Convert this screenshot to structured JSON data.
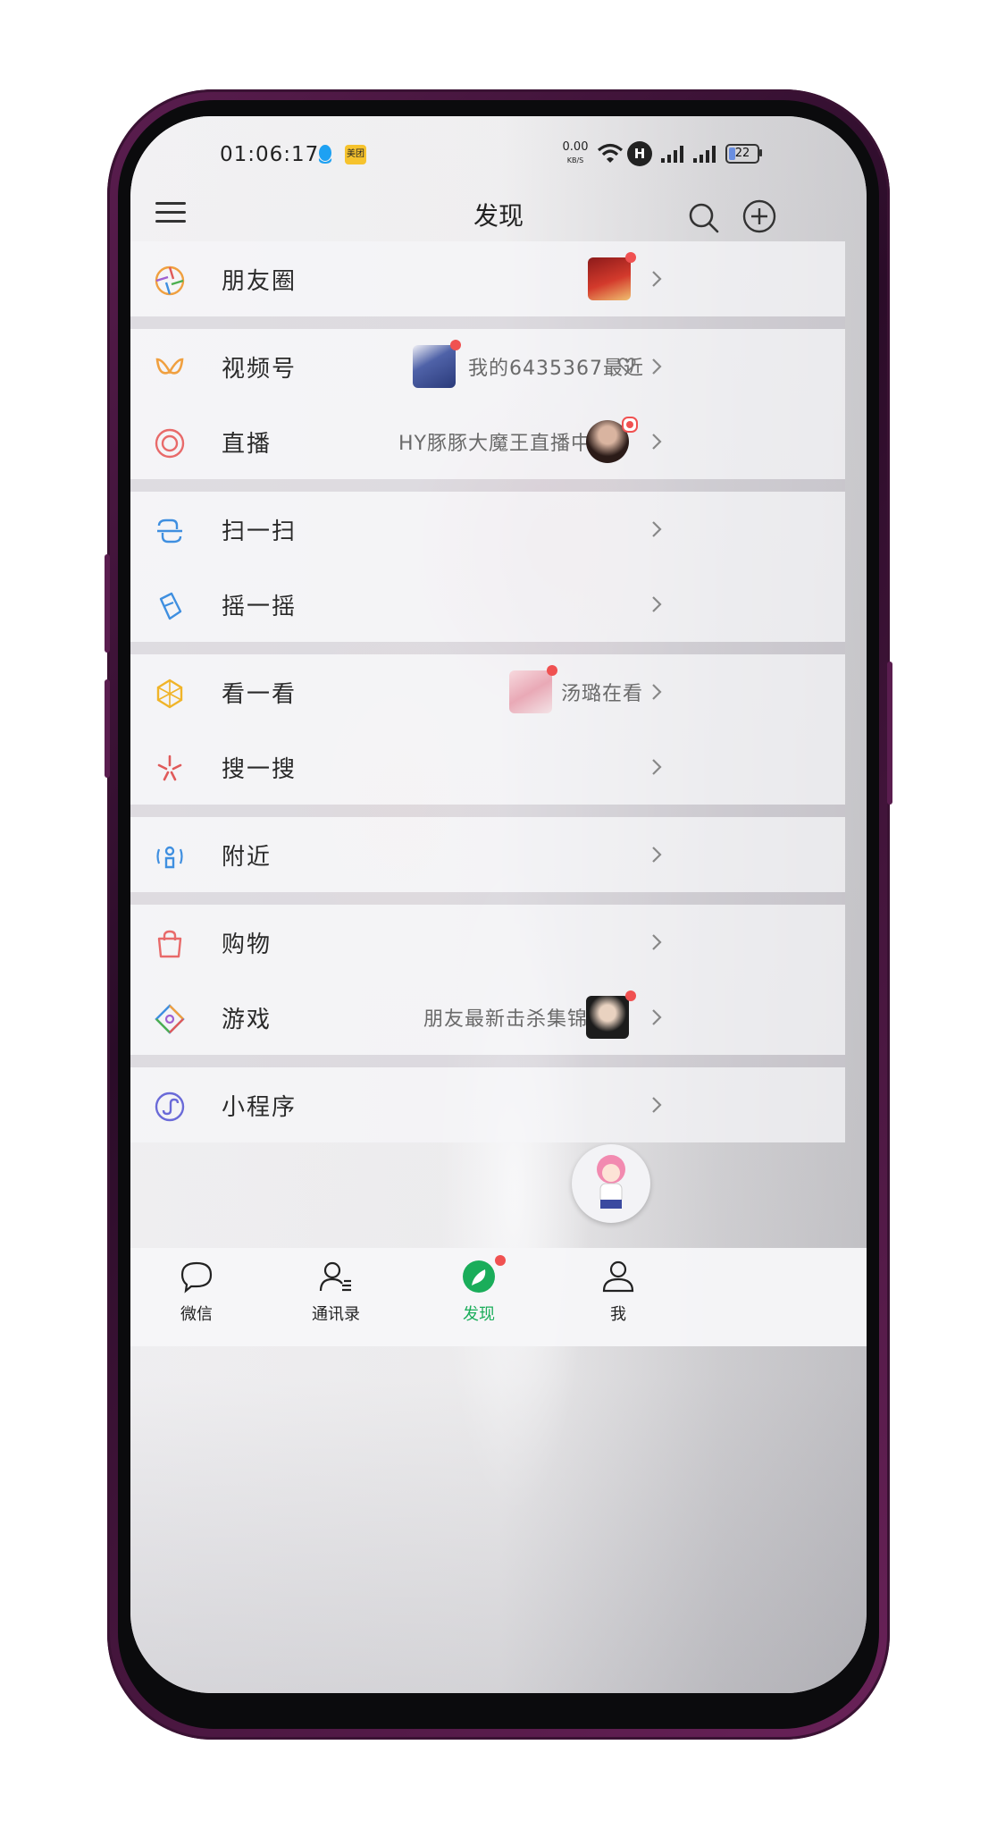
{
  "status_bar": {
    "time": "01:06:17",
    "meituan_label": "美团",
    "net_speed": "0.00",
    "net_speed_unit": "KB/S",
    "hd_badge": "H",
    "battery": "22"
  },
  "header": {
    "title": "发现"
  },
  "list": [
    {
      "label": "朋友圈",
      "sub": ""
    },
    {
      "label": "视频号",
      "sub": "我的6435367最近"
    },
    {
      "label": "直播",
      "sub": "HY豚豚大魔王直播中"
    },
    {
      "label": "扫一扫",
      "sub": ""
    },
    {
      "label": "摇一摇",
      "sub": ""
    },
    {
      "label": "看一看",
      "sub": "汤璐在看"
    },
    {
      "label": "搜一搜",
      "sub": ""
    },
    {
      "label": "附近",
      "sub": ""
    },
    {
      "label": "购物",
      "sub": ""
    },
    {
      "label": "游戏",
      "sub": "朋友最新击杀集锦"
    },
    {
      "label": "小程序",
      "sub": ""
    }
  ],
  "tabbar": {
    "tabs": [
      {
        "label": "微信",
        "active": false
      },
      {
        "label": "通讯录",
        "active": false
      },
      {
        "label": "发现",
        "active": true
      },
      {
        "label": "我",
        "active": false
      }
    ]
  },
  "colors": {
    "accent": "#1aad5a",
    "badge": "#f05151",
    "frame": "#5b1d4f"
  },
  "icons": [
    "menu-icon",
    "search-icon",
    "add-icon",
    "moments-icon",
    "channels-icon",
    "live-icon",
    "scan-icon",
    "shake-icon",
    "top-stories-icon",
    "search-feature-icon",
    "nearby-icon",
    "shopping-icon",
    "games-icon",
    "mini-programs-icon",
    "chevron-right-icon"
  ]
}
